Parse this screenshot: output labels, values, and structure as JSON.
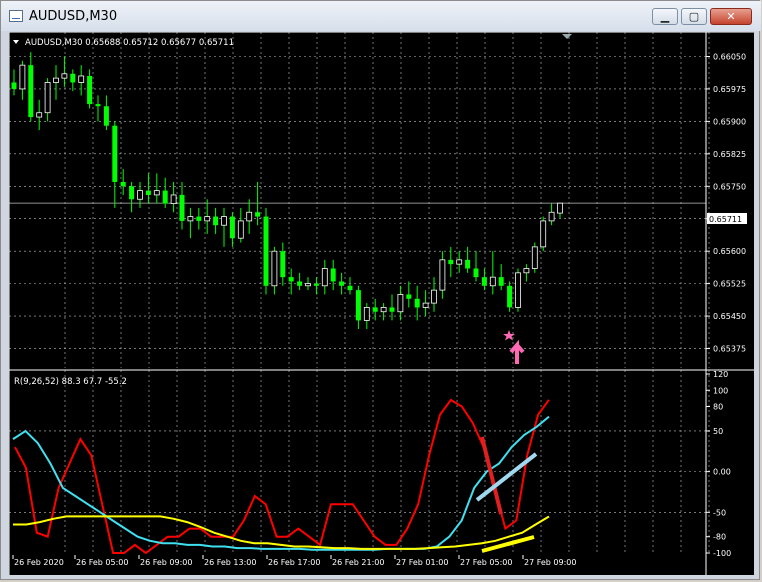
{
  "window": {
    "title": "AUDUSD,M30",
    "buttons": {
      "minimize": "▁",
      "maximize": "▢",
      "close": "✕"
    }
  },
  "main_chart": {
    "header": "AUDUSD,M30  0.65688 0.65712 0.65677 0.65711",
    "current_price_label": "0.65711",
    "colors": {
      "background": "#000000",
      "bull": "#00ff00",
      "bear": "#00ff00",
      "grid": "#c0c0c0",
      "arrow": "#ff69b4"
    }
  },
  "indicator": {
    "header": "R(9,26,52) 88.3 67.7 -55.2",
    "colors": {
      "fast": "#ff0000",
      "medium": "#40e0f0",
      "slow": "#ffff00",
      "trend_red": "#e02020",
      "trend_blue": "#a0d8ef"
    }
  },
  "chart_data": [
    {
      "type": "candlestick",
      "symbol": "AUDUSD",
      "timeframe": "M30",
      "ohlc_header": [
        0.65688,
        0.65712,
        0.65677,
        0.65711
      ],
      "ylim": [
        0.6533,
        0.66065
      ],
      "y_ticks": [
        "0.66050",
        "0.65975",
        "0.65900",
        "0.65825",
        "0.65750",
        "0.65675",
        "0.65600",
        "0.65525",
        "0.65450",
        "0.65375"
      ],
      "x_ticks": [
        "26 Feb 2020",
        "26 Feb 05:00",
        "26 Feb 09:00",
        "26 Feb 13:00",
        "26 Feb 17:00",
        "26 Feb 21:00",
        "27 Feb 01:00",
        "27 Feb 05:00",
        "27 Feb 09:00"
      ],
      "candles": [
        [
          0.6599,
          0.6602,
          0.6596,
          0.65975
        ],
        [
          0.65975,
          0.6604,
          0.6595,
          0.6603
        ],
        [
          0.6603,
          0.6606,
          0.659,
          0.6591
        ],
        [
          0.6591,
          0.6595,
          0.6588,
          0.6592
        ],
        [
          0.6592,
          0.66,
          0.659,
          0.6599
        ],
        [
          0.6599,
          0.6603,
          0.6595,
          0.66
        ],
        [
          0.66,
          0.6605,
          0.6598,
          0.6601
        ],
        [
          0.6601,
          0.6602,
          0.6597,
          0.6599
        ],
        [
          0.6599,
          0.6603,
          0.6596,
          0.66005
        ],
        [
          0.66005,
          0.6602,
          0.6593,
          0.6594
        ],
        [
          0.6594,
          0.6596,
          0.659,
          0.65935
        ],
        [
          0.65935,
          0.6596,
          0.6588,
          0.6589
        ],
        [
          0.6589,
          0.659,
          0.657,
          0.6576
        ],
        [
          0.6576,
          0.6579,
          0.6573,
          0.6575
        ],
        [
          0.6575,
          0.6576,
          0.6569,
          0.6572
        ],
        [
          0.6572,
          0.6576,
          0.657,
          0.6574
        ],
        [
          0.6574,
          0.6578,
          0.6571,
          0.6573
        ],
        [
          0.6573,
          0.6578,
          0.6571,
          0.6574
        ],
        [
          0.6574,
          0.6577,
          0.657,
          0.6571
        ],
        [
          0.6571,
          0.6576,
          0.6569,
          0.6573
        ],
        [
          0.6573,
          0.6576,
          0.6565,
          0.6567
        ],
        [
          0.6567,
          0.657,
          0.6563,
          0.6568
        ],
        [
          0.6568,
          0.657,
          0.6565,
          0.6567
        ],
        [
          0.6567,
          0.6572,
          0.6564,
          0.6568
        ],
        [
          0.6568,
          0.657,
          0.6564,
          0.6566
        ],
        [
          0.6566,
          0.657,
          0.6561,
          0.6568
        ],
        [
          0.6568,
          0.6569,
          0.6561,
          0.6563
        ],
        [
          0.6563,
          0.657,
          0.6562,
          0.6567
        ],
        [
          0.6567,
          0.6572,
          0.6564,
          0.6569
        ],
        [
          0.6569,
          0.6576,
          0.6566,
          0.6568
        ],
        [
          0.6568,
          0.657,
          0.655,
          0.6552
        ],
        [
          0.6552,
          0.6561,
          0.655,
          0.656
        ],
        [
          0.656,
          0.6562,
          0.6552,
          0.6554
        ],
        [
          0.6554,
          0.6556,
          0.655,
          0.6553
        ],
        [
          0.6553,
          0.6555,
          0.6551,
          0.6552
        ],
        [
          0.6552,
          0.6554,
          0.6551,
          0.65525
        ],
        [
          0.65525,
          0.6554,
          0.655,
          0.6552
        ],
        [
          0.6552,
          0.6558,
          0.655,
          0.6556
        ],
        [
          0.6556,
          0.6558,
          0.6551,
          0.6553
        ],
        [
          0.6553,
          0.6555,
          0.655,
          0.6552
        ],
        [
          0.6552,
          0.6554,
          0.655,
          0.6551
        ],
        [
          0.6551,
          0.6552,
          0.6542,
          0.6544
        ],
        [
          0.6544,
          0.6548,
          0.6542,
          0.6547
        ],
        [
          0.6547,
          0.6549,
          0.6544,
          0.6546
        ],
        [
          0.6546,
          0.6548,
          0.6544,
          0.6547
        ],
        [
          0.6547,
          0.655,
          0.6544,
          0.6546
        ],
        [
          0.6546,
          0.6552,
          0.6544,
          0.655
        ],
        [
          0.655,
          0.6553,
          0.6547,
          0.6549
        ],
        [
          0.6549,
          0.6552,
          0.6544,
          0.6547
        ],
        [
          0.6547,
          0.6551,
          0.6545,
          0.6548
        ],
        [
          0.6548,
          0.6554,
          0.6546,
          0.6551
        ],
        [
          0.6551,
          0.656,
          0.6549,
          0.6558
        ],
        [
          0.6558,
          0.6561,
          0.6554,
          0.6557
        ],
        [
          0.6557,
          0.656,
          0.6555,
          0.6558
        ],
        [
          0.6558,
          0.6561,
          0.6555,
          0.6556
        ],
        [
          0.6556,
          0.656,
          0.6553,
          0.6554
        ],
        [
          0.6554,
          0.6556,
          0.6551,
          0.6552
        ],
        [
          0.6552,
          0.656,
          0.655,
          0.6554
        ],
        [
          0.6554,
          0.6557,
          0.6551,
          0.6552
        ],
        [
          0.6552,
          0.6553,
          0.6546,
          0.6547
        ],
        [
          0.6547,
          0.6556,
          0.6546,
          0.6555
        ],
        [
          0.6555,
          0.6557,
          0.6553,
          0.6556
        ],
        [
          0.6556,
          0.6562,
          0.6555,
          0.6561
        ],
        [
          0.6561,
          0.6568,
          0.656,
          0.6567
        ],
        [
          0.6567,
          0.6571,
          0.6566,
          0.6569
        ],
        [
          0.65688,
          0.65712,
          0.65677,
          0.65711
        ]
      ]
    },
    {
      "type": "line",
      "title": "R(9,26,52) 88.3 67.7 -55.2",
      "ylim": [
        -100,
        120
      ],
      "y_ticks": [
        "120",
        "100",
        "80",
        "50",
        "0.00",
        "-50",
        "-80",
        "-100"
      ],
      "series": [
        {
          "name": "R(9)",
          "values": [
            30,
            5,
            -75,
            -80,
            -20,
            10,
            40,
            20,
            -40,
            -100,
            -100,
            -90,
            -100,
            -90,
            -80,
            -80,
            -70,
            -70,
            -80,
            -80,
            -80,
            -60,
            -30,
            -40,
            -80,
            -80,
            -70,
            -80,
            -90,
            -40,
            -40,
            -40,
            -60,
            -80,
            -90,
            -90,
            -70,
            -40,
            20,
            70,
            88,
            80,
            60,
            30,
            -20,
            -70,
            -60,
            20,
            70,
            88.3
          ]
        },
        {
          "name": "R(26)",
          "values": [
            40,
            50,
            35,
            10,
            -20,
            -30,
            -40,
            -50,
            -60,
            -70,
            -80,
            -85,
            -88,
            -88,
            -90,
            -90,
            -92,
            -92,
            -94,
            -94,
            -95,
            -95,
            -95,
            -95,
            -96,
            -96,
            -96,
            -96,
            -96,
            -96,
            -95,
            -95,
            -95,
            -95,
            -92,
            -80,
            -60,
            -20,
            0,
            10,
            30,
            45,
            55,
            67.7
          ]
        },
        {
          "name": "R(52)",
          "values": [
            -65,
            -65,
            -62,
            -58,
            -55,
            -55,
            -55,
            -55,
            -55,
            -55,
            -55,
            -55,
            -58,
            -62,
            -68,
            -75,
            -80,
            -85,
            -88,
            -88,
            -90,
            -92,
            -92,
            -93,
            -94,
            -94,
            -95,
            -95,
            -95,
            -95,
            -95,
            -94,
            -93,
            -92,
            -90,
            -88,
            -85,
            -80,
            -75,
            -65,
            -55.2
          ]
        }
      ]
    }
  ]
}
